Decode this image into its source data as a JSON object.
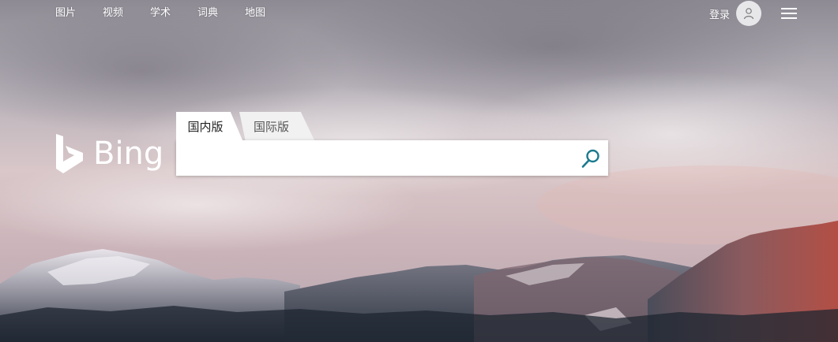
{
  "nav": {
    "items": [
      "图片",
      "视频",
      "学术",
      "词典",
      "地图"
    ]
  },
  "account": {
    "login_label": "登录",
    "avatar_icon": "person-icon",
    "menu_icon": "hamburger-menu-icon"
  },
  "logo": {
    "text": "Bing"
  },
  "search": {
    "tabs": [
      {
        "label": "国内版",
        "active": true
      },
      {
        "label": "国际版",
        "active": false
      }
    ],
    "query": "",
    "placeholder": "",
    "button_icon": "search-icon",
    "accent_color": "#1a7a8e"
  }
}
